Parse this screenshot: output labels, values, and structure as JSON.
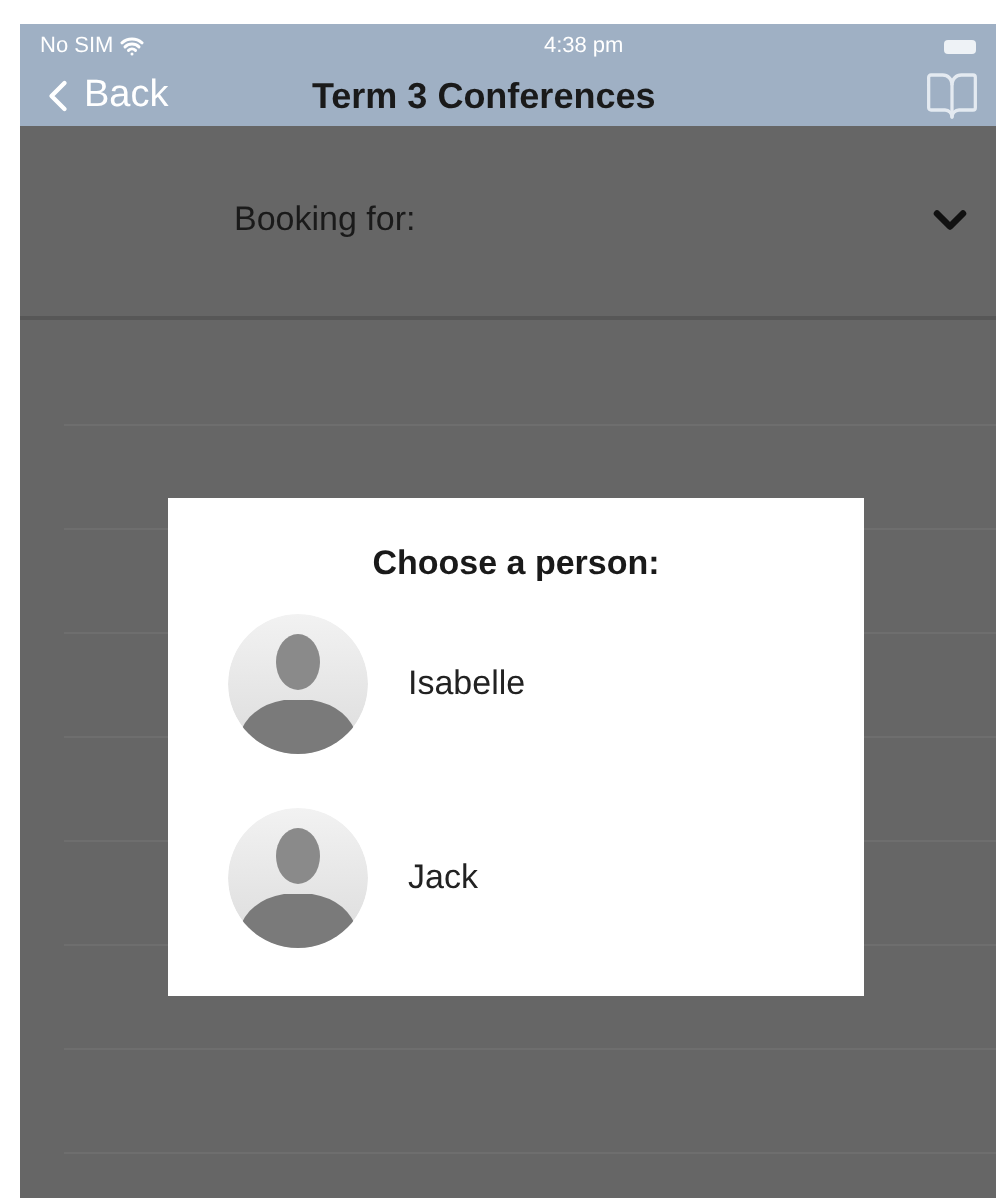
{
  "status_bar": {
    "carrier": "No SIM",
    "time": "4:38 pm"
  },
  "nav_bar": {
    "back": "Back",
    "title": "Term 3 Conferences"
  },
  "booking": {
    "label": "Booking for:"
  },
  "dialog": {
    "title": "Choose a person:",
    "people": [
      {
        "name": "Isabelle"
      },
      {
        "name": "Jack"
      }
    ]
  }
}
